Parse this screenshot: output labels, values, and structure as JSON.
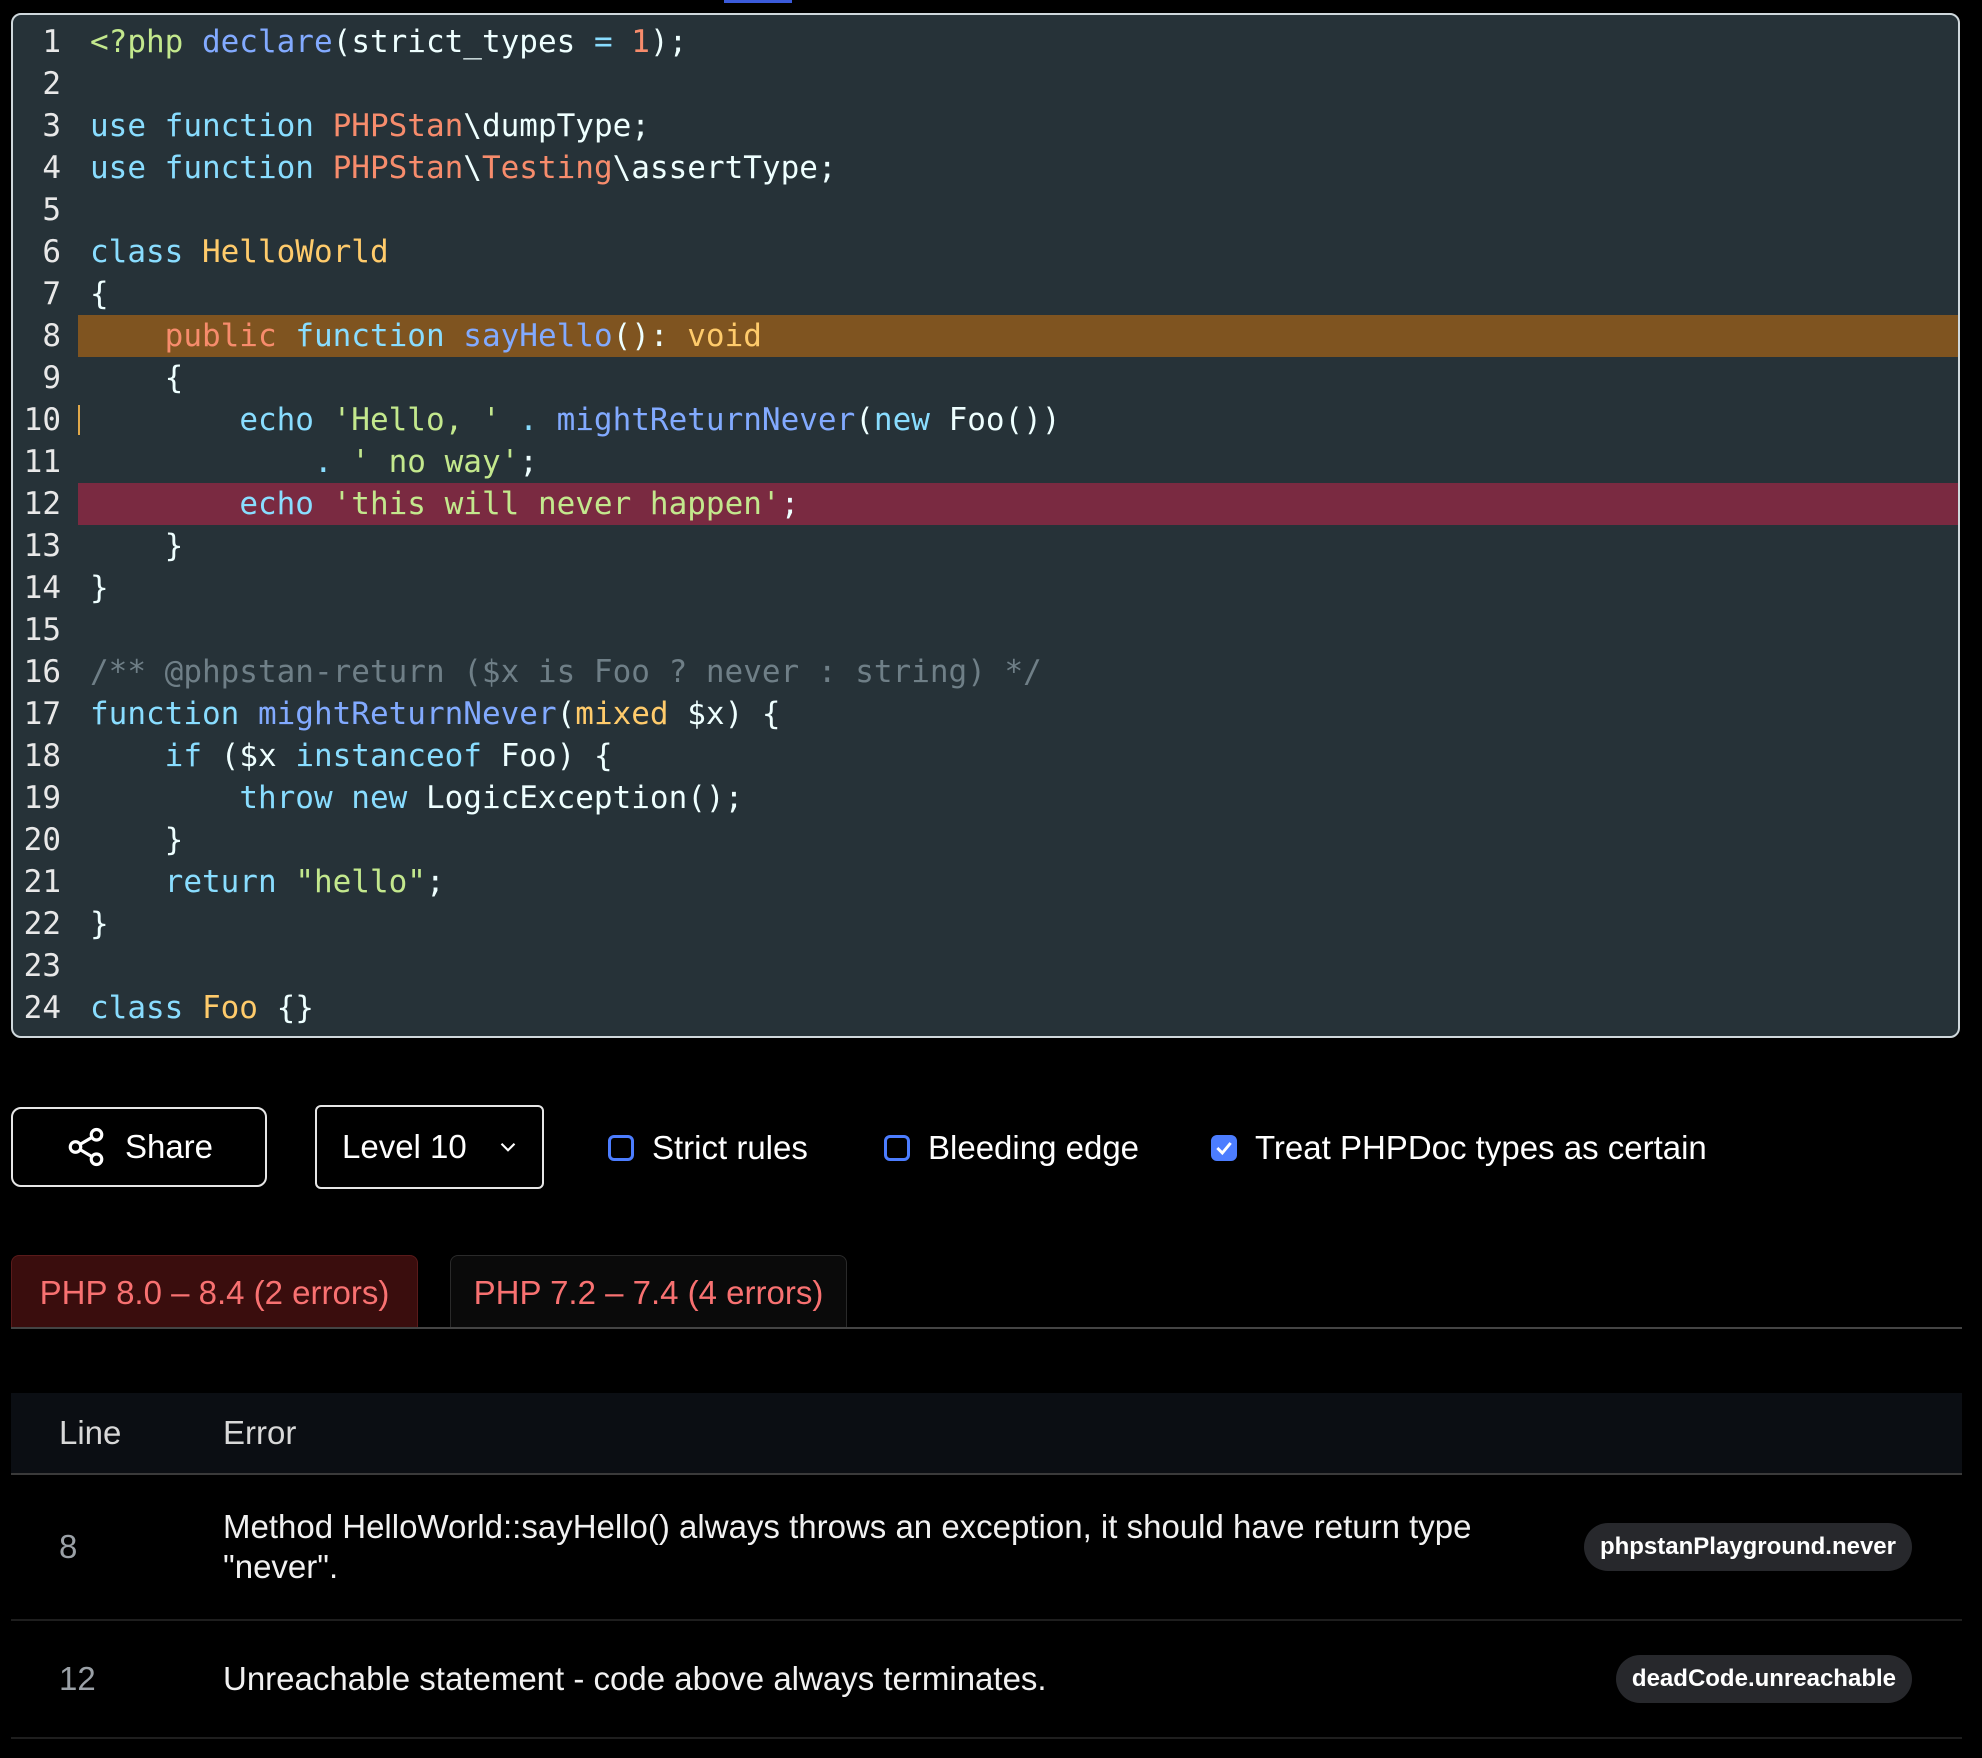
{
  "editor": {
    "lines": [
      {
        "no": "1",
        "tokens": [
          [
            "t-tag",
            "<?php "
          ],
          [
            "t-fn",
            "declare"
          ],
          [
            "t-punc",
            "("
          ],
          [
            "t-plain",
            "strict_types "
          ],
          [
            "t-kw",
            "= "
          ],
          [
            "t-num",
            "1"
          ],
          [
            "t-punc",
            ");"
          ]
        ]
      },
      {
        "no": "2",
        "tokens": []
      },
      {
        "no": "3",
        "tokens": [
          [
            "t-kw",
            "use "
          ],
          [
            "t-kw",
            "function "
          ],
          [
            "t-ns",
            "PHPStan"
          ],
          [
            "t-plain",
            "\\dumpType;"
          ]
        ]
      },
      {
        "no": "4",
        "tokens": [
          [
            "t-kw",
            "use "
          ],
          [
            "t-kw",
            "function "
          ],
          [
            "t-ns",
            "PHPStan"
          ],
          [
            "t-plain",
            "\\"
          ],
          [
            "t-ns",
            "Testing"
          ],
          [
            "t-plain",
            "\\assertType;"
          ]
        ]
      },
      {
        "no": "5",
        "tokens": []
      },
      {
        "no": "6",
        "tokens": [
          [
            "t-kw",
            "class "
          ],
          [
            "t-cls",
            "HelloWorld"
          ]
        ]
      },
      {
        "no": "7",
        "tokens": [
          [
            "t-punc",
            "{"
          ]
        ]
      },
      {
        "no": "8",
        "highlight": "warn",
        "tokens": [
          [
            "t-plain",
            "    "
          ],
          [
            "t-mod",
            "public "
          ],
          [
            "t-kw",
            "function "
          ],
          [
            "t-fn",
            "sayHello"
          ],
          [
            "t-punc",
            "(): "
          ],
          [
            "t-type",
            "void"
          ]
        ]
      },
      {
        "no": "9",
        "tokens": [
          [
            "t-punc",
            "    {"
          ]
        ]
      },
      {
        "no": "10",
        "cursor": true,
        "tokens": [
          [
            "t-plain",
            "        "
          ],
          [
            "t-kw",
            "echo "
          ],
          [
            "t-str",
            "'Hello, ' "
          ],
          [
            "t-kw",
            ". "
          ],
          [
            "t-fn",
            "mightReturnNever"
          ],
          [
            "t-punc",
            "("
          ],
          [
            "t-kw",
            "new "
          ],
          [
            "t-plain",
            "Foo())"
          ]
        ]
      },
      {
        "no": "11",
        "tokens": [
          [
            "t-plain",
            "            "
          ],
          [
            "t-kw",
            ". "
          ],
          [
            "t-str",
            "' no way'"
          ],
          [
            "t-punc",
            ";"
          ]
        ]
      },
      {
        "no": "12",
        "highlight": "error",
        "tokens": [
          [
            "t-plain",
            "        "
          ],
          [
            "t-kw",
            "echo "
          ],
          [
            "t-str",
            "'this will never happen'"
          ],
          [
            "t-punc",
            ";"
          ]
        ]
      },
      {
        "no": "13",
        "tokens": [
          [
            "t-punc",
            "    }"
          ]
        ]
      },
      {
        "no": "14",
        "tokens": [
          [
            "t-punc",
            "}"
          ]
        ]
      },
      {
        "no": "15",
        "tokens": []
      },
      {
        "no": "16",
        "tokens": [
          [
            "t-com",
            "/** @phpstan-return ($x is Foo ? never : string) */"
          ]
        ]
      },
      {
        "no": "17",
        "tokens": [
          [
            "t-kw",
            "function "
          ],
          [
            "t-fn",
            "mightReturnNever"
          ],
          [
            "t-punc",
            "("
          ],
          [
            "t-type",
            "mixed "
          ],
          [
            "t-plain",
            "$x) {"
          ]
        ]
      },
      {
        "no": "18",
        "tokens": [
          [
            "t-plain",
            "    "
          ],
          [
            "t-kw",
            "if "
          ],
          [
            "t-plain",
            "($x "
          ],
          [
            "t-kw",
            "instanceof "
          ],
          [
            "t-plain",
            "Foo) {"
          ]
        ]
      },
      {
        "no": "19",
        "tokens": [
          [
            "t-plain",
            "        "
          ],
          [
            "t-kw",
            "throw "
          ],
          [
            "t-kw",
            "new "
          ],
          [
            "t-plain",
            "LogicException();"
          ]
        ]
      },
      {
        "no": "20",
        "tokens": [
          [
            "t-punc",
            "    }"
          ]
        ]
      },
      {
        "no": "21",
        "tokens": [
          [
            "t-plain",
            "    "
          ],
          [
            "t-kw",
            "return "
          ],
          [
            "t-str",
            "\"hello\""
          ],
          [
            "t-punc",
            ";"
          ]
        ]
      },
      {
        "no": "22",
        "tokens": [
          [
            "t-punc",
            "}"
          ]
        ]
      },
      {
        "no": "23",
        "tokens": []
      },
      {
        "no": "24",
        "tokens": [
          [
            "t-kw",
            "class "
          ],
          [
            "t-cls",
            "Foo "
          ],
          [
            "t-punc",
            "{}"
          ]
        ]
      }
    ]
  },
  "toolbar": {
    "share_label": "Share",
    "level_label": "Level 10",
    "strict_rules": {
      "label": "Strict rules",
      "checked": false
    },
    "bleeding_edge": {
      "label": "Bleeding edge",
      "checked": false
    },
    "phpdoc_certain": {
      "label": "Treat PHPDoc types as certain",
      "checked": true
    }
  },
  "tabs": [
    {
      "label": "PHP 8.0 – 8.4 (2 errors)",
      "active": true
    },
    {
      "label": "PHP 7.2 – 7.4 (4 errors)",
      "active": false
    }
  ],
  "errors": {
    "headers": {
      "line": "Line",
      "error": "Error"
    },
    "rows": [
      {
        "line": "8",
        "message": "Method HelloWorld::sayHello() always throws an exception, it should have return type \"never\".",
        "identifier": "phpstanPlayground.never"
      },
      {
        "line": "12",
        "message": "Unreachable statement - code above always terminates.",
        "identifier": "deadCode.unreachable"
      }
    ]
  },
  "colors": {
    "accent": "#4c7dff",
    "warn_line": "#7f5420",
    "error_line": "#7a2a41",
    "error_text": "#f87171"
  }
}
